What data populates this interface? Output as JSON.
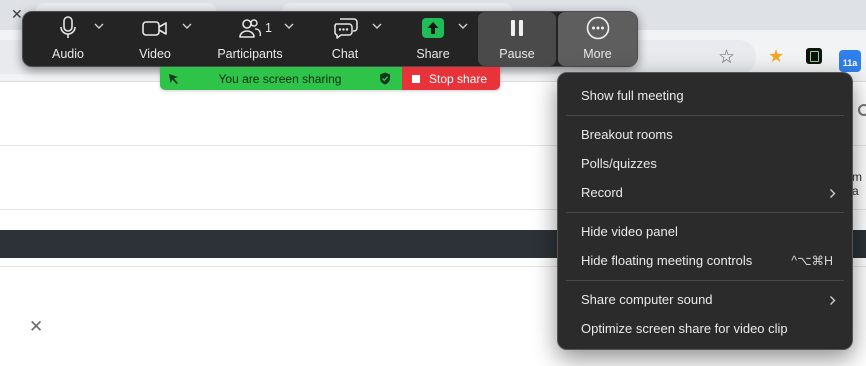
{
  "toolbar": {
    "audio": {
      "label": "Audio",
      "icon": "microphone-icon"
    },
    "video": {
      "label": "Video",
      "icon": "video-camera-icon"
    },
    "participants": {
      "label": "Participants",
      "count": "1",
      "icon": "participants-icon"
    },
    "chat": {
      "label": "Chat",
      "icon": "chat-bubbles-icon"
    },
    "share": {
      "label": "Share",
      "icon": "share-arrow-icon",
      "color": "#1fbd58"
    },
    "pause": {
      "label": "Pause",
      "icon": "pause-icon"
    },
    "more": {
      "label": "More",
      "icon": "ellipsis-icon"
    }
  },
  "share_banner": {
    "status_text": "You are screen sharing",
    "status_color": "#2ec44a",
    "stop_label": "Stop share",
    "stop_color": "#e8333a"
  },
  "more_menu": {
    "items": [
      {
        "label": "Show full meeting",
        "shortcut": "",
        "submenu": false
      },
      {
        "label": "Breakout rooms",
        "shortcut": "",
        "submenu": false
      },
      {
        "label": "Polls/quizzes",
        "shortcut": "",
        "submenu": false
      },
      {
        "label": "Record",
        "shortcut": "",
        "submenu": true
      },
      {
        "label": "Hide video panel",
        "shortcut": "",
        "submenu": false
      },
      {
        "label": "Hide floating meeting controls",
        "shortcut": "^⌥⌘H",
        "submenu": false
      },
      {
        "label": "Share computer sound",
        "shortcut": "",
        "submenu": true
      },
      {
        "label": "Optimize screen share for video clip",
        "shortcut": "",
        "submenu": false
      }
    ]
  },
  "background": {
    "calendar_badge": "11a",
    "right_edge_text": "m a"
  }
}
